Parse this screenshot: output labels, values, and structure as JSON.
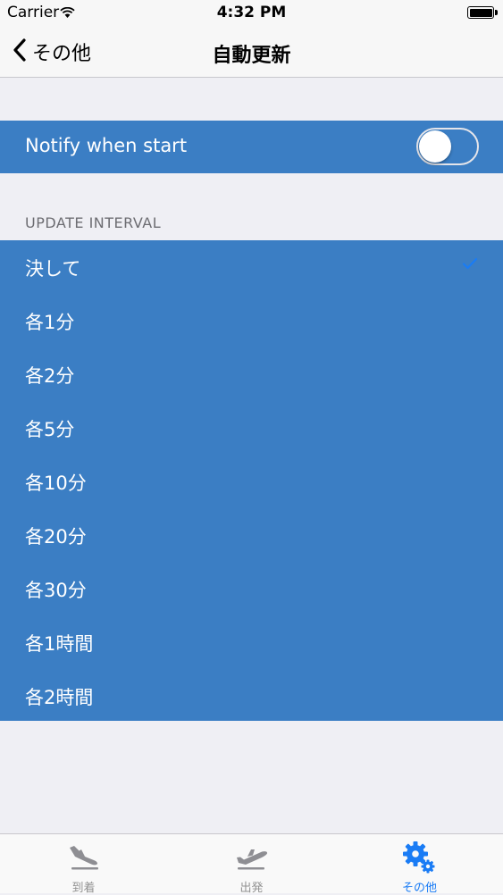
{
  "status_bar": {
    "carrier": "Carrier",
    "time": "4:32 PM"
  },
  "nav": {
    "back_label": "その他",
    "title": "自動更新"
  },
  "notify": {
    "label": "Notify when start",
    "enabled": false
  },
  "interval": {
    "header": "UPDATE INTERVAL",
    "options": [
      {
        "label": "決して",
        "selected": true
      },
      {
        "label": "各1分",
        "selected": false
      },
      {
        "label": "各2分",
        "selected": false
      },
      {
        "label": "各5分",
        "selected": false
      },
      {
        "label": "各10分",
        "selected": false
      },
      {
        "label": "各20分",
        "selected": false
      },
      {
        "label": "各30分",
        "selected": false
      },
      {
        "label": "各1時間",
        "selected": false
      },
      {
        "label": "各2時間",
        "selected": false
      }
    ]
  },
  "tabbar": {
    "tabs": [
      {
        "label": "到着",
        "icon": "arrival-plane-icon",
        "active": false
      },
      {
        "label": "出発",
        "icon": "departure-plane-icon",
        "active": false
      },
      {
        "label": "その他",
        "icon": "gears-icon",
        "active": true
      }
    ]
  },
  "colors": {
    "row_background": "#3b7ec4",
    "accent": "#1a7cf5",
    "inactive_tab": "#929292"
  }
}
